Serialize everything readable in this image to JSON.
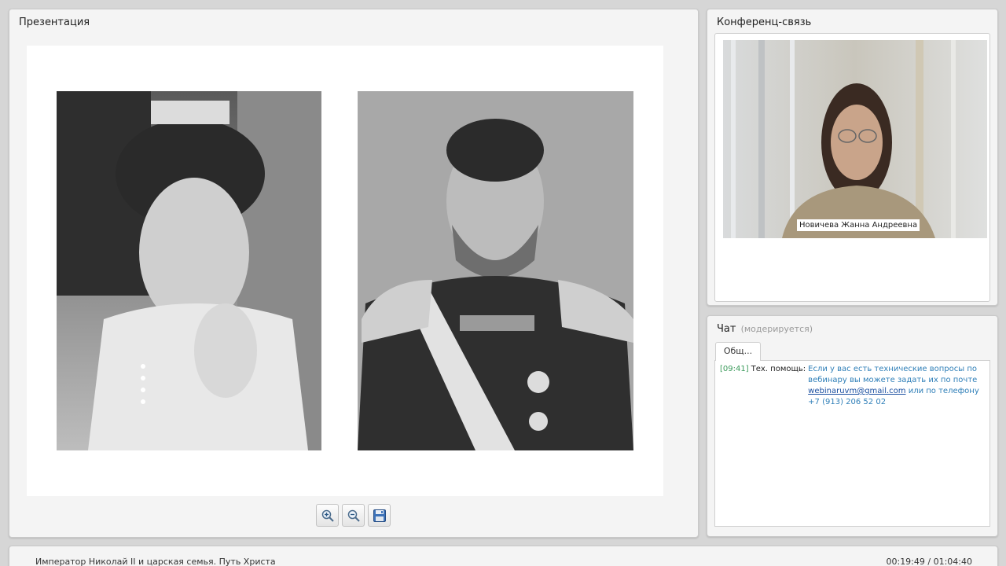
{
  "presentation": {
    "title": "Презентация",
    "toolbar": {
      "zoom_in": "zoom-in-icon",
      "zoom_out": "zoom-out-icon",
      "save": "save-icon"
    }
  },
  "conference": {
    "title": "Конференц-связь",
    "speaker_name": "Новичева Жанна Андреевна"
  },
  "chat": {
    "title": "Чат",
    "moderated_note": "(модерируется)",
    "tab_label": "Общ...",
    "messages": [
      {
        "time": "[09:41]",
        "author": "Тех. помощь:",
        "text_before": "Если у вас есть технические вопросы по вебинару вы можете задать их по почте",
        "email": "webinaruvm@gmail.com",
        "text_after": "или по телефону +7 (913) 206 52 02"
      }
    ]
  },
  "footer": {
    "webinar_title": "Император Николай II и царская семья. Путь Христа",
    "timer": "00:19:49 / 01:04:40"
  },
  "colors": {
    "background": "#d6d6d6",
    "panel": "#f4f4f4",
    "chat_time": "#3a9a5a",
    "chat_text": "#2f7fb8",
    "chat_link": "#1a4fa0"
  }
}
